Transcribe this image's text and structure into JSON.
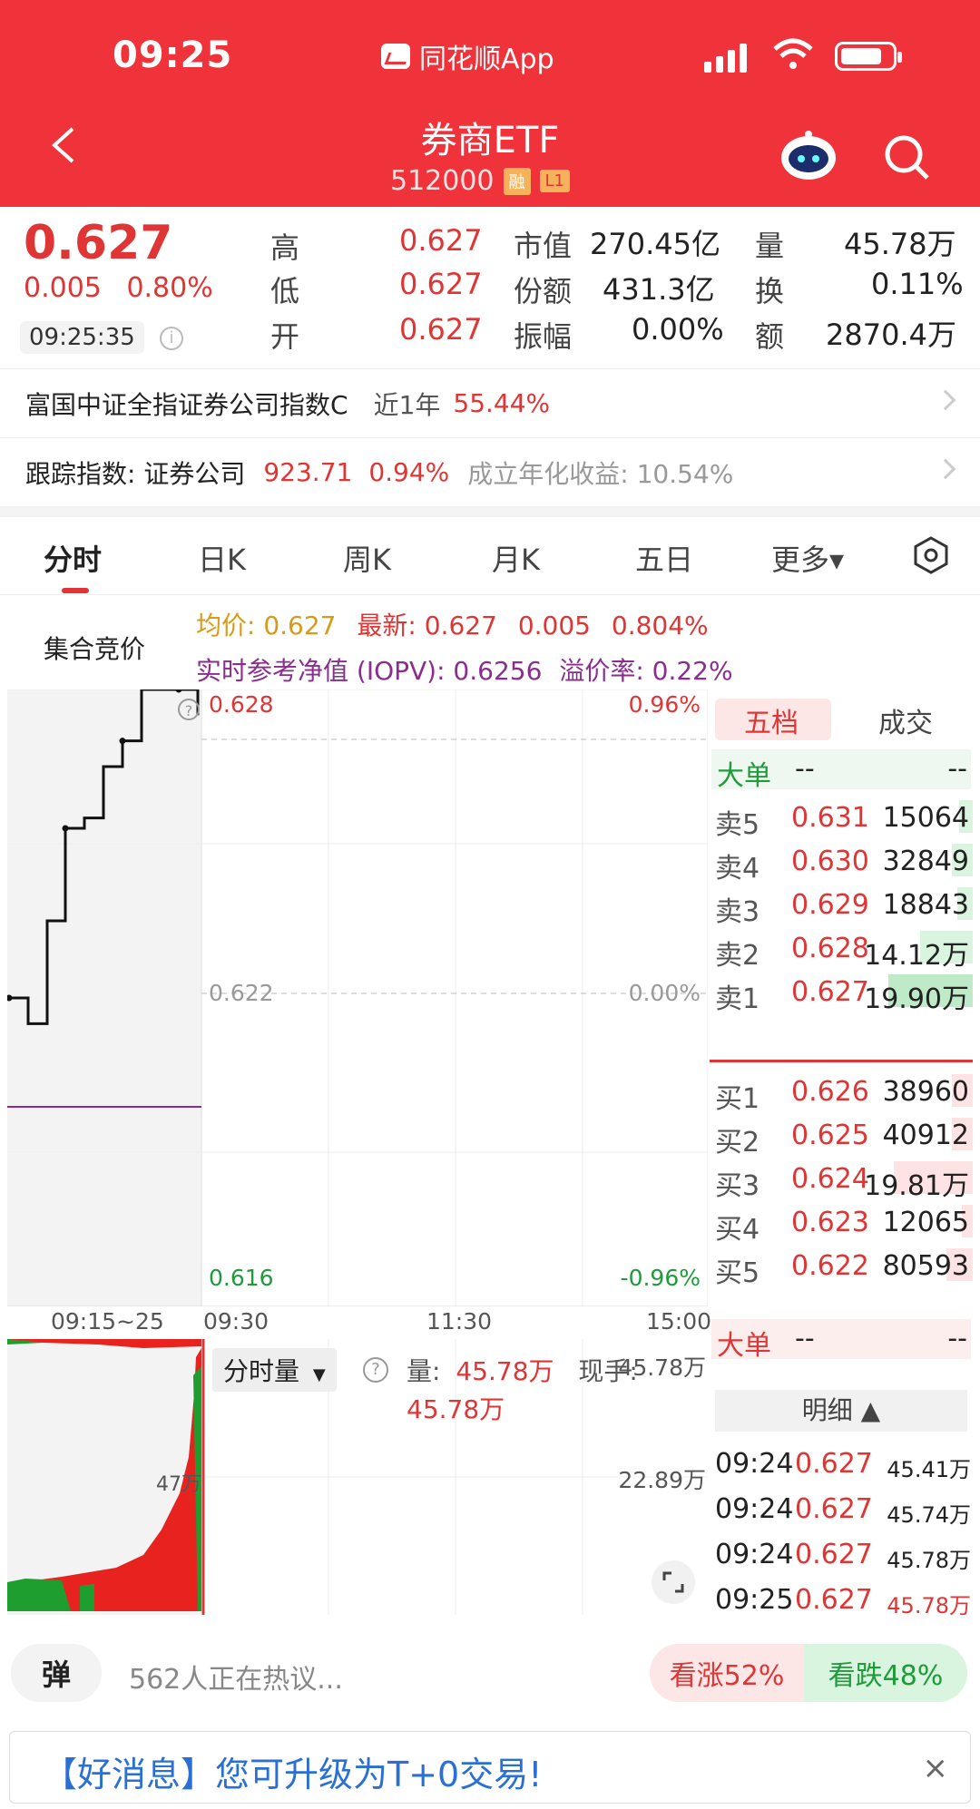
{
  "status_bar": {
    "time": "09:25",
    "app_name": "同花顺App"
  },
  "header": {
    "title": "券商ETF",
    "code": "512000",
    "tag_margin": "融",
    "tag_level": "L1"
  },
  "quote": {
    "price": "0.627",
    "change": "0.005",
    "change_pct": "0.80%",
    "time": "09:25:35",
    "fields": [
      {
        "label": "高",
        "value": "0.627"
      },
      {
        "label": "低",
        "value": "0.627"
      },
      {
        "label": "开",
        "value": "0.627"
      },
      {
        "label": "市值",
        "value": "270.45亿"
      },
      {
        "label": "份额",
        "value": "431.3亿"
      },
      {
        "label": "振幅",
        "value": "0.00%"
      },
      {
        "label": "量",
        "value": "45.78万"
      },
      {
        "label": "换",
        "value": "0.11%"
      },
      {
        "label": "额",
        "value": "2870.4万"
      }
    ]
  },
  "index_link": {
    "name": "富国中证全指证券公司指数C",
    "period": "近1年",
    "return": "55.44%"
  },
  "tracking": {
    "label": "跟踪指数: 证券公司",
    "value": "923.71",
    "pct": "0.94%",
    "annual_label": "成立年化收益: 10.54%"
  },
  "tabs": [
    "分时",
    "日K",
    "周K",
    "月K",
    "五日",
    "更多▾"
  ],
  "chart_header": {
    "auction_label": "集合竞价",
    "avg_label": "均价: 0.627",
    "latest_label": "最新: 0.627",
    "latest_change": "0.005",
    "latest_pct": "0.804%",
    "iopv_label": "实时参考净值 (IOPV): 0.6256",
    "premium_label": "溢价率: 0.22%"
  },
  "chart_data": {
    "type": "line",
    "y_labels": {
      "top": "0.628",
      "mid": "0.622",
      "bottom": "0.616"
    },
    "pct_labels": {
      "top": "0.96%",
      "mid": "0.00%",
      "bottom": "-0.96%"
    },
    "x_labels": [
      "09:15~25",
      "09:30",
      "11:30",
      "15:00"
    ],
    "auction_price_steps": [
      0.622,
      0.6215,
      0.6235,
      0.6253,
      0.6255,
      0.6265,
      0.627,
      0.628,
      0.628,
      0.628,
      0.6275
    ],
    "ylim": [
      0.616,
      0.628
    ],
    "iopv": 0.6256
  },
  "volume": {
    "dropdown": "分时量",
    "vol_label": "量:",
    "vol_value": "45.78万",
    "now_label": "现手:",
    "now_value": "45.78万",
    "axis_top": "45.78万",
    "axis_mid": "22.89万",
    "auction_peak": "47万"
  },
  "book": {
    "tab_active": "五档",
    "tab_other": "成交",
    "big_label": "大单",
    "big_placeholder_a": "--",
    "big_placeholder_b": "--",
    "asks": [
      {
        "label": "卖5",
        "price": "0.631",
        "vol": "15064",
        "bar": 0.05,
        "color": "#d9f4df"
      },
      {
        "label": "卖4",
        "price": "0.630",
        "vol": "32849",
        "bar": 0.08,
        "color": "#d9f4df"
      },
      {
        "label": "卖3",
        "price": "0.629",
        "vol": "18843",
        "bar": 0.06,
        "color": "#d9f4df"
      },
      {
        "label": "卖2",
        "price": "0.628",
        "vol": "14.12万",
        "bar": 0.2,
        "color": "#d9f4df"
      },
      {
        "label": "卖1",
        "price": "0.627",
        "vol": "19.90万",
        "bar": 0.32,
        "color": "#bfeac8"
      }
    ],
    "bids": [
      {
        "label": "买1",
        "price": "0.626",
        "vol": "38960",
        "bar": 0.08,
        "color": "#fde3e3"
      },
      {
        "label": "买2",
        "price": "0.625",
        "vol": "40912",
        "bar": 0.08,
        "color": "#fde3e3"
      },
      {
        "label": "买3",
        "price": "0.624",
        "vol": "19.81万",
        "bar": 0.3,
        "color": "#fde3e3"
      },
      {
        "label": "买4",
        "price": "0.623",
        "vol": "12065",
        "bar": 0.04,
        "color": "#fde3e3"
      },
      {
        "label": "买5",
        "price": "0.622",
        "vol": "80593",
        "bar": 0.1,
        "color": "#fde3e3"
      }
    ],
    "detail_label": "明细 ▲"
  },
  "ticks": [
    {
      "time": "09:24",
      "price": "0.627",
      "vol": "45.41万",
      "color": "#222"
    },
    {
      "time": "09:24",
      "price": "0.627",
      "vol": "45.74万",
      "color": "#222"
    },
    {
      "time": "09:24",
      "price": "0.627",
      "vol": "45.78万",
      "color": "#222"
    },
    {
      "time": "09:25",
      "price": "0.627",
      "vol": "45.78万",
      "color": "#e03535"
    }
  ],
  "bottom": {
    "danmu": "弹",
    "comment": "562人正在热议...",
    "bull": "看涨52%",
    "bear": "看跌48%",
    "promo": "【好消息】您可升级为T+0交易!",
    "close": "×"
  },
  "colors": {
    "brand": "#f0333a",
    "up": "#e03535",
    "down": "#1f9b3a"
  }
}
